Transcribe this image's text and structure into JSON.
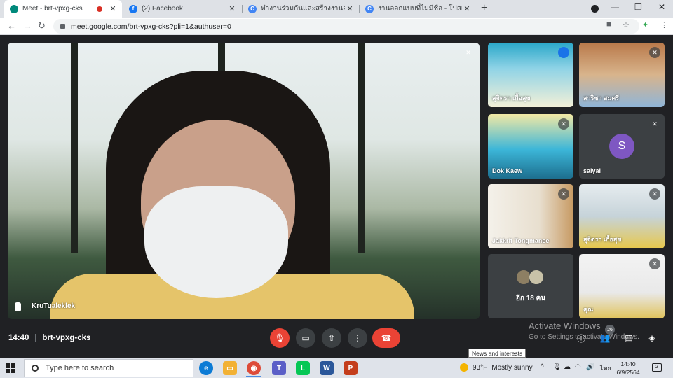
{
  "browser": {
    "tabs": [
      {
        "title": "Meet - brt-vpxg-cks",
        "favicon": "meet-icon",
        "color": "#00897b",
        "recording": true
      },
      {
        "title": "(2) Facebook",
        "favicon": "facebook-icon",
        "color": "#1877f2"
      },
      {
        "title": "ทำงานร่วมกันและสร้างงานออกแบบกร",
        "favicon": "canva-icon",
        "color": "#4285f4"
      },
      {
        "title": "งานออกแบบที่ไม่มีชื่อ - โปสเตอร์",
        "favicon": "canva-icon",
        "color": "#4285f4"
      }
    ],
    "close_glyph": "✕",
    "new_tab_glyph": "+",
    "url": "meet.google.com/brt-vpxg-cks?pli=1&authuser=0",
    "window_controls": [
      "—",
      "❐",
      "✕"
    ]
  },
  "meet": {
    "main_speaker": {
      "name": "KruTualeklek"
    },
    "tiles": [
      {
        "name": "สุจิตรา เกื้อสุข",
        "kind": "screen-share",
        "speaking": true
      },
      {
        "name": "สาริชา สมศรี",
        "kind": "camera",
        "muted": true
      },
      {
        "name": "Dok Kaew",
        "kind": "screen-share",
        "muted": true
      },
      {
        "name": "saiyai",
        "kind": "avatar",
        "initial": "S",
        "avatar_color": "#7e57c2",
        "muted": true
      },
      {
        "name": "Jakkrit Tongmanee",
        "kind": "camera",
        "muted": true
      },
      {
        "name": "สุจิตรา เกื้อสุข",
        "kind": "camera",
        "muted": true
      },
      {
        "name": "",
        "kind": "others",
        "more_label": "อีก 18 คน"
      },
      {
        "name": "คุณ",
        "kind": "camera",
        "muted": true
      }
    ],
    "time": "14:40",
    "meeting_code": "brt-vpxg-cks",
    "participants_count": "26",
    "watermark": {
      "line1": "Activate Windows",
      "line2": "Go to Settings to activate Windows."
    },
    "tooltip": "News and interests"
  },
  "taskbar": {
    "search_placeholder": "Type here to search",
    "apps": [
      {
        "name": "edge",
        "label": "e",
        "color": "#0c7bd5"
      },
      {
        "name": "file-explorer",
        "label": "▭",
        "color": "#f2b134"
      },
      {
        "name": "chrome",
        "label": "◉",
        "color": "#dd4b39"
      },
      {
        "name": "teams",
        "label": "T",
        "color": "#5b5fc7"
      },
      {
        "name": "line",
        "label": "L",
        "color": "#06c755"
      },
      {
        "name": "word",
        "label": "W",
        "color": "#2b579a"
      },
      {
        "name": "powerpoint",
        "label": "P",
        "color": "#c43e1c"
      }
    ],
    "weather_temp": "93°F",
    "weather_text": "Mostly sunny",
    "language": "ไทย",
    "clock_time": "14:40",
    "clock_date": "6/9/2564"
  }
}
